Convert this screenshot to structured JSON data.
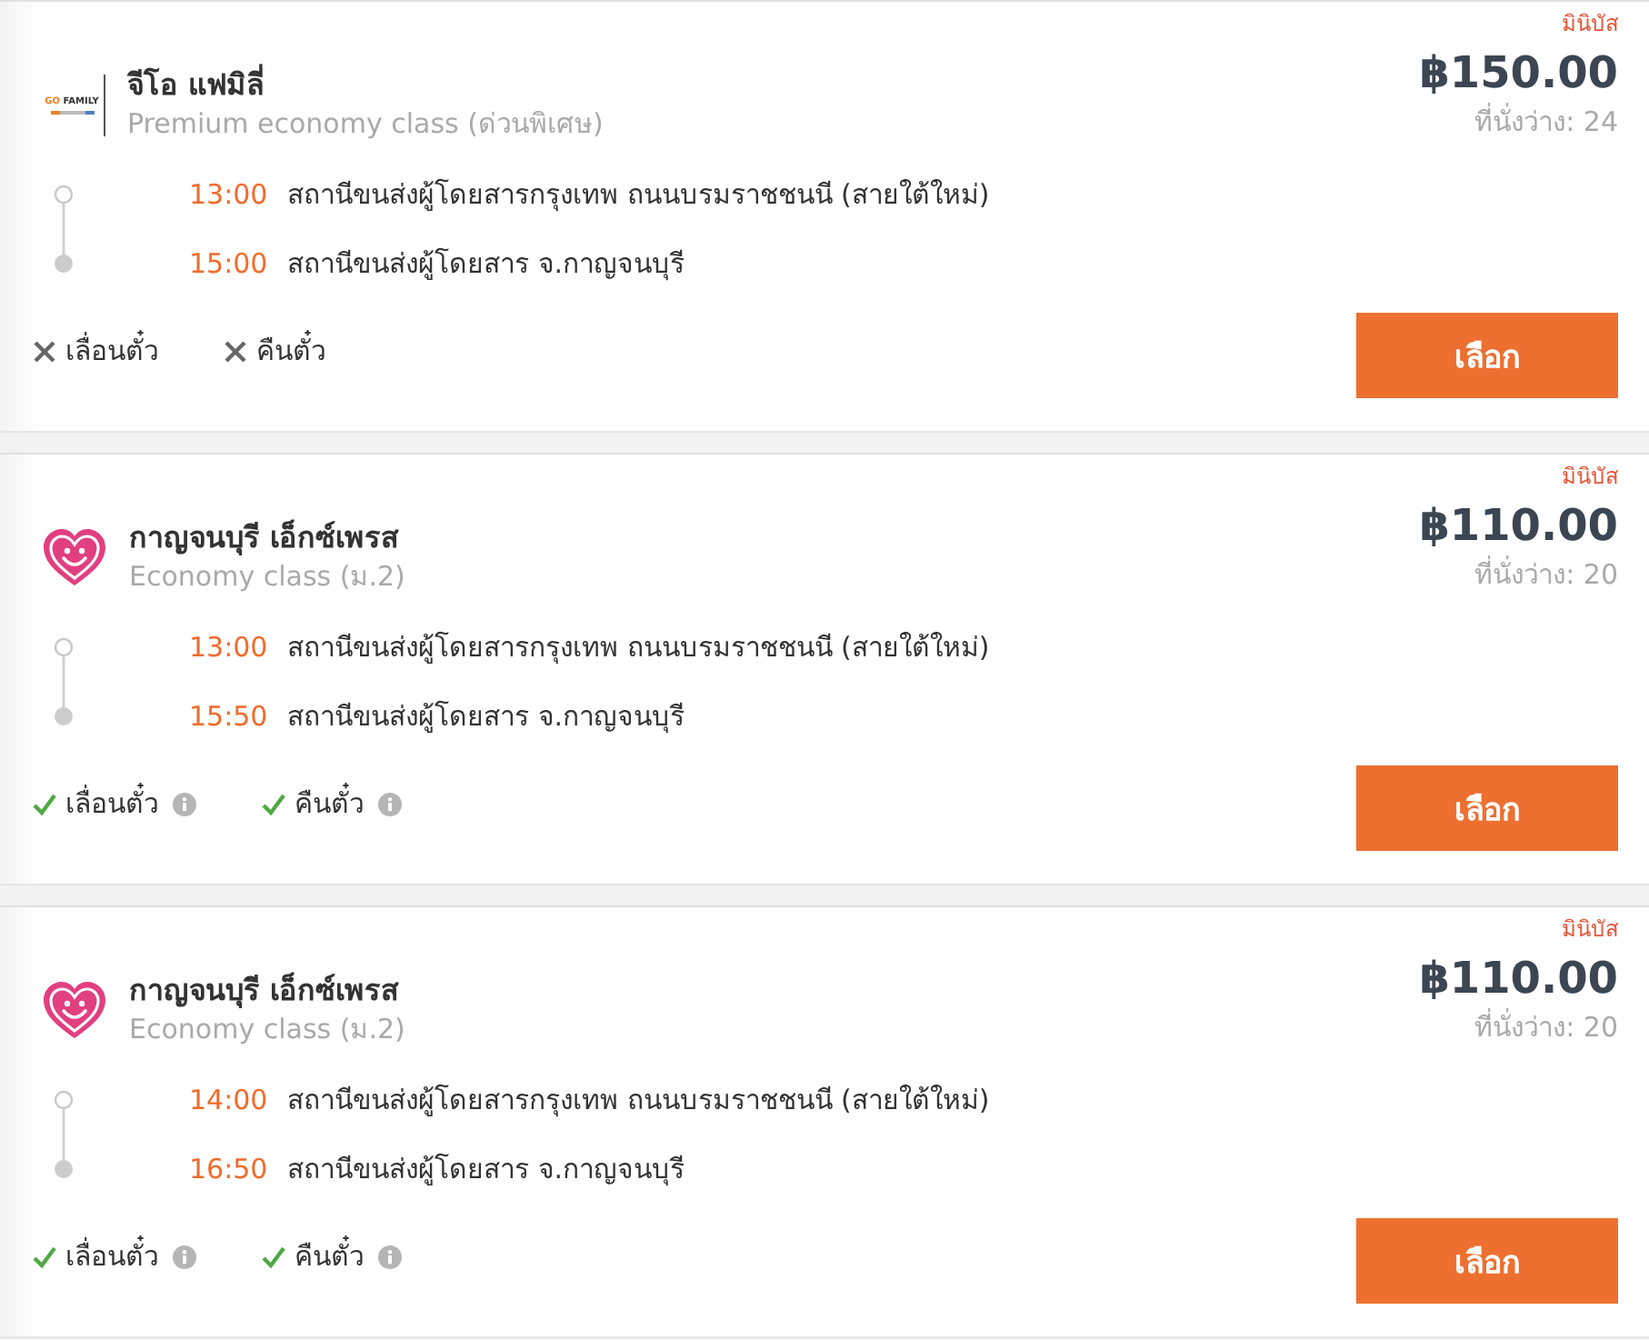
{
  "trips": [
    {
      "bus_type": "มินิบัส",
      "price": "฿150.00",
      "seats": "ที่นั่งว่าง: 24",
      "operator": {
        "name": "จีโอ แฟมิลี่",
        "class": "Premium economy class (ด่วนพิเศษ)",
        "logo": {
          "kind": "wordmark",
          "words": [
            "GO",
            "FAMILY"
          ]
        }
      },
      "stops": [
        {
          "kind": "origin",
          "time": "13:00",
          "station": "สถานีขนส่งผู้โดยสารกรุงเทพ ถนนบรมราชชนนี (สายใต้ใหม่)"
        },
        {
          "kind": "destination",
          "time": "15:00",
          "station": "สถานีขนส่งผู้โดยสาร จ.กาญจนบุรี"
        }
      ],
      "policies": [
        {
          "label": "เลื่อนตั๋ว",
          "allowed": false
        },
        {
          "label": "คืนตั๋ว",
          "allowed": false
        }
      ],
      "button": "เลือก"
    },
    {
      "bus_type": "มินิบัส",
      "price": "฿110.00",
      "seats": "ที่นั่งว่าง: 20",
      "operator": {
        "name": "กาญจนบุรี เอ็กซ์เพรส",
        "class": "Economy class (ม.2)",
        "logo": {
          "kind": "heart"
        }
      },
      "stops": [
        {
          "kind": "origin",
          "time": "13:00",
          "station": "สถานีขนส่งผู้โดยสารกรุงเทพ ถนนบรมราชชนนี (สายใต้ใหม่)"
        },
        {
          "kind": "destination",
          "time": "15:50",
          "station": "สถานีขนส่งผู้โดยสาร จ.กาญจนบุรี"
        }
      ],
      "policies": [
        {
          "label": "เลื่อนตั๋ว",
          "allowed": true
        },
        {
          "label": "คืนตั๋ว",
          "allowed": true
        }
      ],
      "button": "เลือก"
    },
    {
      "bus_type": "มินิบัส",
      "price": "฿110.00",
      "seats": "ที่นั่งว่าง: 20",
      "operator": {
        "name": "กาญจนบุรี เอ็กซ์เพรส",
        "class": "Economy class (ม.2)",
        "logo": {
          "kind": "heart"
        }
      },
      "stops": [
        {
          "kind": "origin",
          "time": "14:00",
          "station": "สถานีขนส่งผู้โดยสารกรุงเทพ ถนนบรมราชชนนี (สายใต้ใหม่)"
        },
        {
          "kind": "destination",
          "time": "16:50",
          "station": "สถานีขนส่งผู้โดยสาร จ.กาญจนบุรี"
        }
      ],
      "policies": [
        {
          "label": "เลื่อนตั๋ว",
          "allowed": true
        },
        {
          "label": "คืนตั๋ว",
          "allowed": true
        }
      ],
      "button": "เลือก"
    }
  ]
}
